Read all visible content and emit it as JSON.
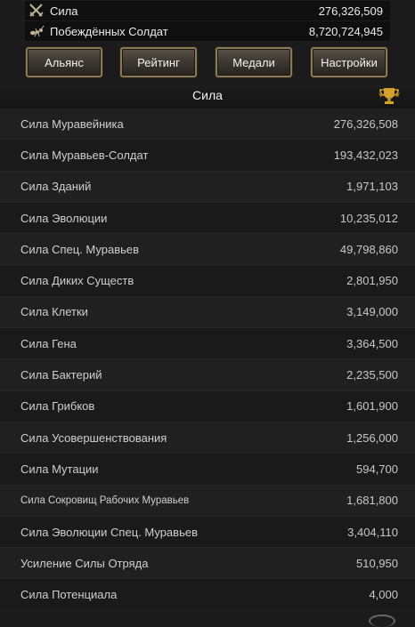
{
  "stats": [
    {
      "label": "Сила",
      "value": "276,326,509",
      "icon": "crossed-swords-icon"
    },
    {
      "label": "Побеждённых Солдат",
      "value": "8,720,724,945",
      "icon": "ant-soldier-icon"
    }
  ],
  "tabs": [
    {
      "label": "Альянс"
    },
    {
      "label": "Рейтинг"
    },
    {
      "label": "Медали"
    },
    {
      "label": "Настройки"
    }
  ],
  "section": {
    "title": "Сила",
    "icon": "trophy-icon"
  },
  "rows": [
    {
      "label": "Сила Муравейника",
      "value": "276,326,508"
    },
    {
      "label": "Сила Муравьев-Солдат",
      "value": "193,432,023"
    },
    {
      "label": "Сила Зданий",
      "value": "1,971,103"
    },
    {
      "label": "Сила Эволюции",
      "value": "10,235,012"
    },
    {
      "label": "Сила Спец. Муравьев",
      "value": "49,798,860"
    },
    {
      "label": "Сила Диких Существ",
      "value": "2,801,950"
    },
    {
      "label": "Сила Клетки",
      "value": "3,149,000"
    },
    {
      "label": "Сила Гена",
      "value": "3,364,500"
    },
    {
      "label": "Сила Бактерий",
      "value": "2,235,500"
    },
    {
      "label": "Сила Грибков",
      "value": "1,601,900"
    },
    {
      "label": "Сила Усовершенствования",
      "value": "1,256,000"
    },
    {
      "label": "Сила Мутации",
      "value": "594,700"
    },
    {
      "label": "Сила Сокровищ Рабочих Муравьев",
      "value": "1,681,800"
    },
    {
      "label": "Сила Эволюции Спец. Муравьев",
      "value": "3,404,110"
    },
    {
      "label": "Усиление Силы Отряда",
      "value": "510,950"
    },
    {
      "label": "Сила Потенциала",
      "value": "4,000"
    }
  ],
  "colors": {
    "background": "#1b1b1b",
    "button_border": "#8c7a52",
    "trophy": "#d4a12a"
  }
}
